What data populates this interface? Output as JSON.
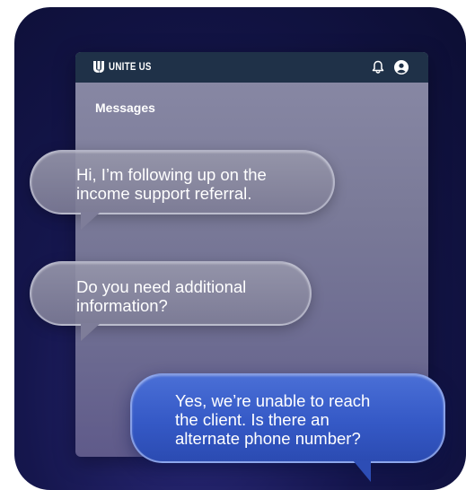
{
  "app": {
    "brand": "UNITE US",
    "page_title": "Messages"
  },
  "icons": {
    "logo": "unite-us-logo-icon",
    "notifications": "bell-icon",
    "account": "user-circle-icon"
  },
  "messages": [
    {
      "sender": "incoming",
      "text": "Hi, I’m following up on the\nincome support referral."
    },
    {
      "sender": "incoming",
      "text": "Do you need additional\ninformation?"
    },
    {
      "sender": "outgoing",
      "text": "Yes, we’re unable to reach\nthe client. Is there an\nalternate phone number?"
    }
  ],
  "colors": {
    "background": "#15164d",
    "topbar": "#1f3148",
    "incoming_bubble": "#8a89a6",
    "outgoing_bubble": "#3a5ccb"
  }
}
